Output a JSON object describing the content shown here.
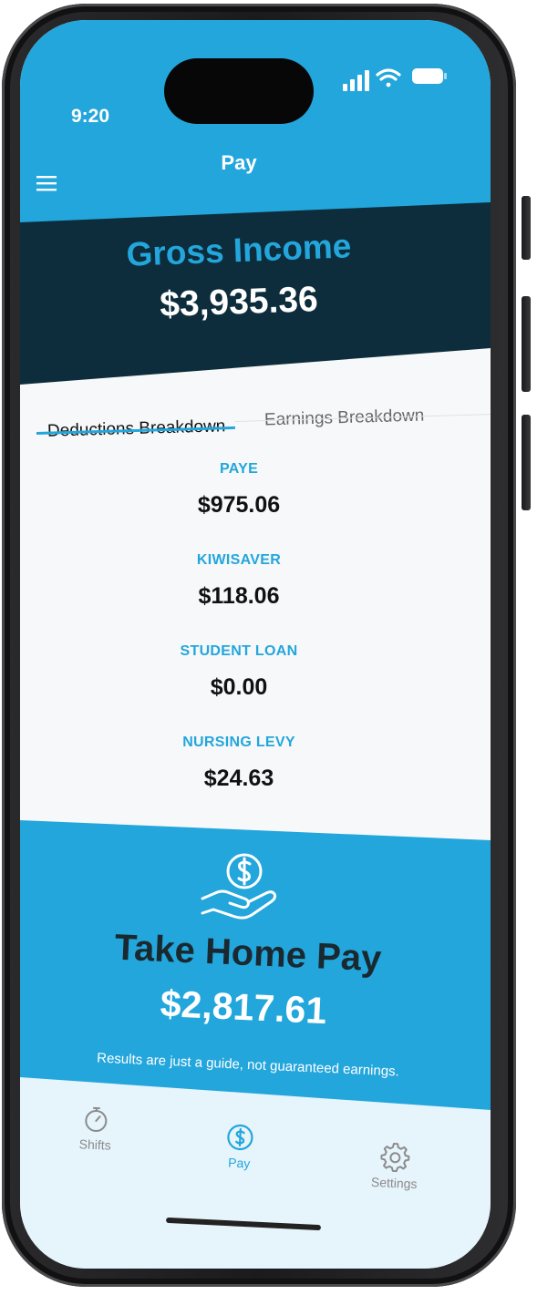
{
  "status_bar": {
    "time": "9:20"
  },
  "header": {
    "title": "Pay",
    "menu_icon": "hamburger-menu-icon"
  },
  "gross": {
    "label": "Gross Income",
    "value": "$3,935.36"
  },
  "tabs": [
    {
      "label": "Deductions Breakdown",
      "active": true
    },
    {
      "label": "Earnings Breakdown",
      "active": false
    }
  ],
  "deductions": [
    {
      "label": "PAYE",
      "value": "$975.06"
    },
    {
      "label": "KIWISAVER",
      "value": "$118.06"
    },
    {
      "label": "STUDENT LOAN",
      "value": "$0.00"
    },
    {
      "label": "NURSING LEVY",
      "value": "$24.63"
    }
  ],
  "take_home": {
    "icon": "hand-coin-icon",
    "label": "Take Home Pay",
    "value": "$2,817.61",
    "disclaimer": "Results are just a guide, not guaranteed earnings."
  },
  "nav": [
    {
      "label": "Shifts",
      "icon": "stopwatch-icon",
      "active": false
    },
    {
      "label": "Pay",
      "icon": "dollar-coin-icon",
      "active": true
    },
    {
      "label": "Settings",
      "icon": "gear-icon",
      "active": false
    }
  ],
  "colors": {
    "accent": "#23a6dc",
    "header_dark": "#0d2d3c",
    "tabbar_bg": "#e6f4fb"
  }
}
